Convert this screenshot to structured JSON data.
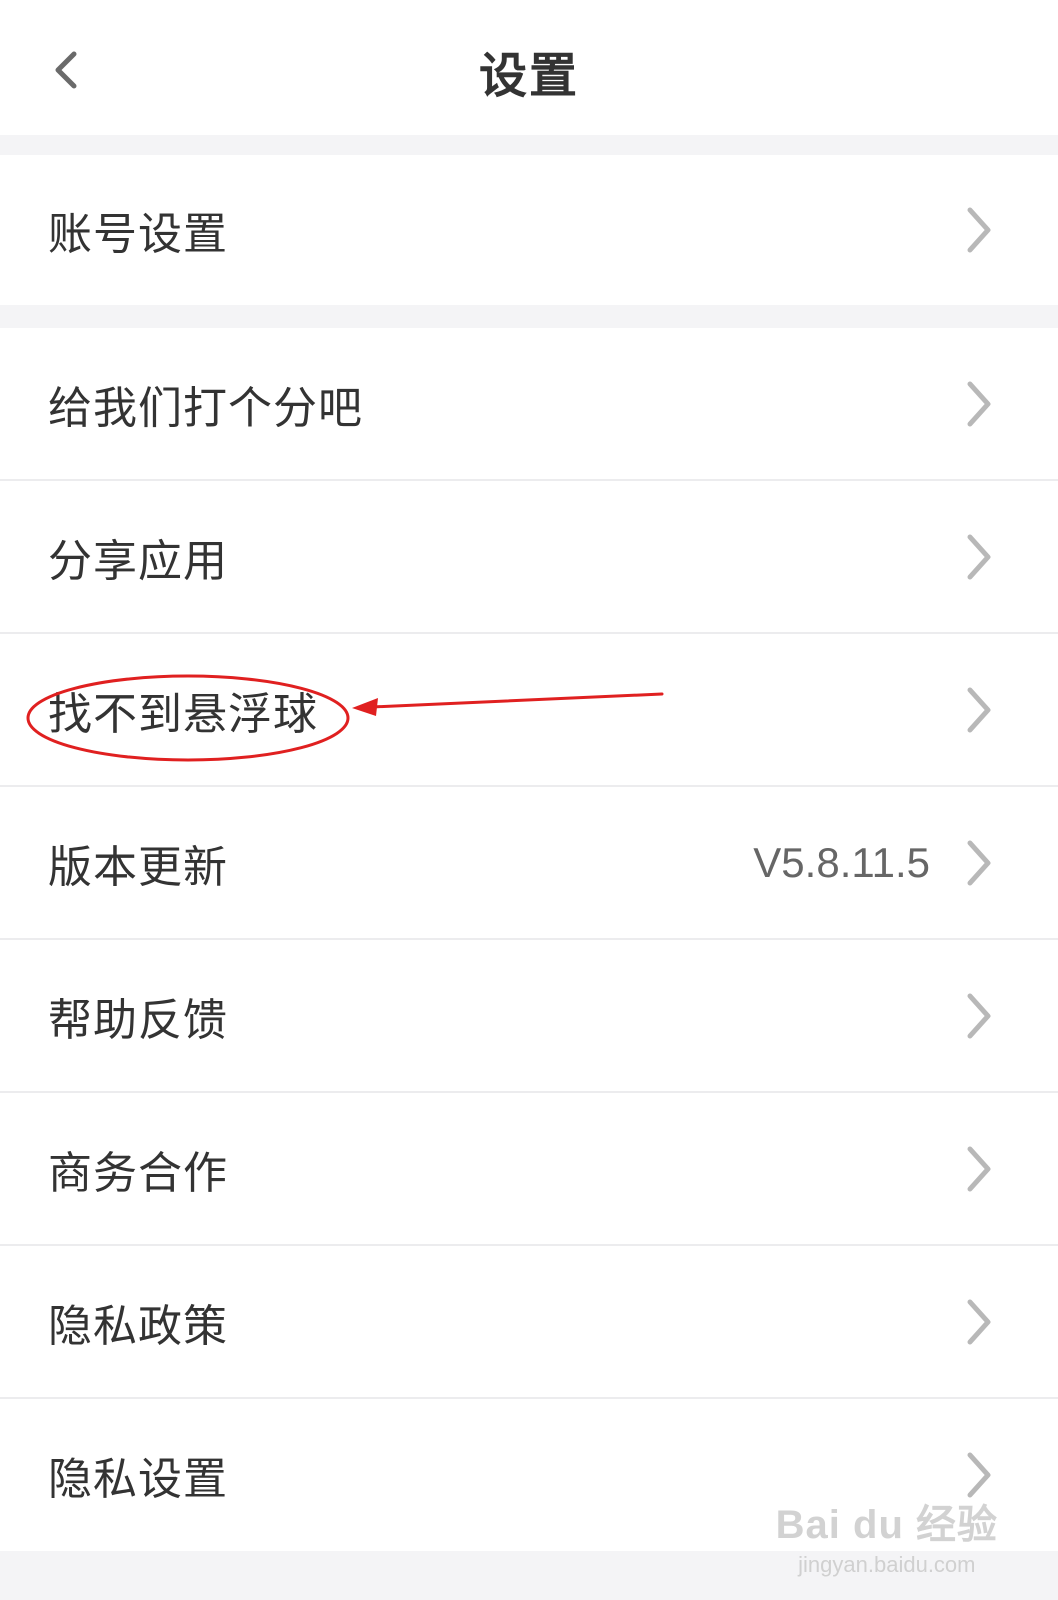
{
  "header": {
    "title": "设置",
    "back_icon": "chevron-left-icon"
  },
  "groups": [
    {
      "items": [
        {
          "label": "账号设置",
          "value": ""
        }
      ]
    },
    {
      "items": [
        {
          "label": "给我们打个分吧",
          "value": ""
        },
        {
          "label": "分享应用",
          "value": ""
        },
        {
          "label": "找不到悬浮球",
          "value": "",
          "highlighted": true
        },
        {
          "label": "版本更新",
          "value": "V5.8.11.5"
        },
        {
          "label": "帮助反馈",
          "value": ""
        },
        {
          "label": "商务合作",
          "value": ""
        },
        {
          "label": "隐私政策",
          "value": ""
        },
        {
          "label": "隐私设置",
          "value": ""
        }
      ]
    }
  ],
  "annotation": {
    "color": "#e02020",
    "target": "找不到悬浮球"
  },
  "watermark": {
    "logo": "Bai du 经验",
    "url": "jingyan.baidu.com"
  },
  "colors": {
    "background": "#f4f4f6",
    "text": "#333333",
    "chevron": "#b8b8b8",
    "divider": "#ececee"
  }
}
